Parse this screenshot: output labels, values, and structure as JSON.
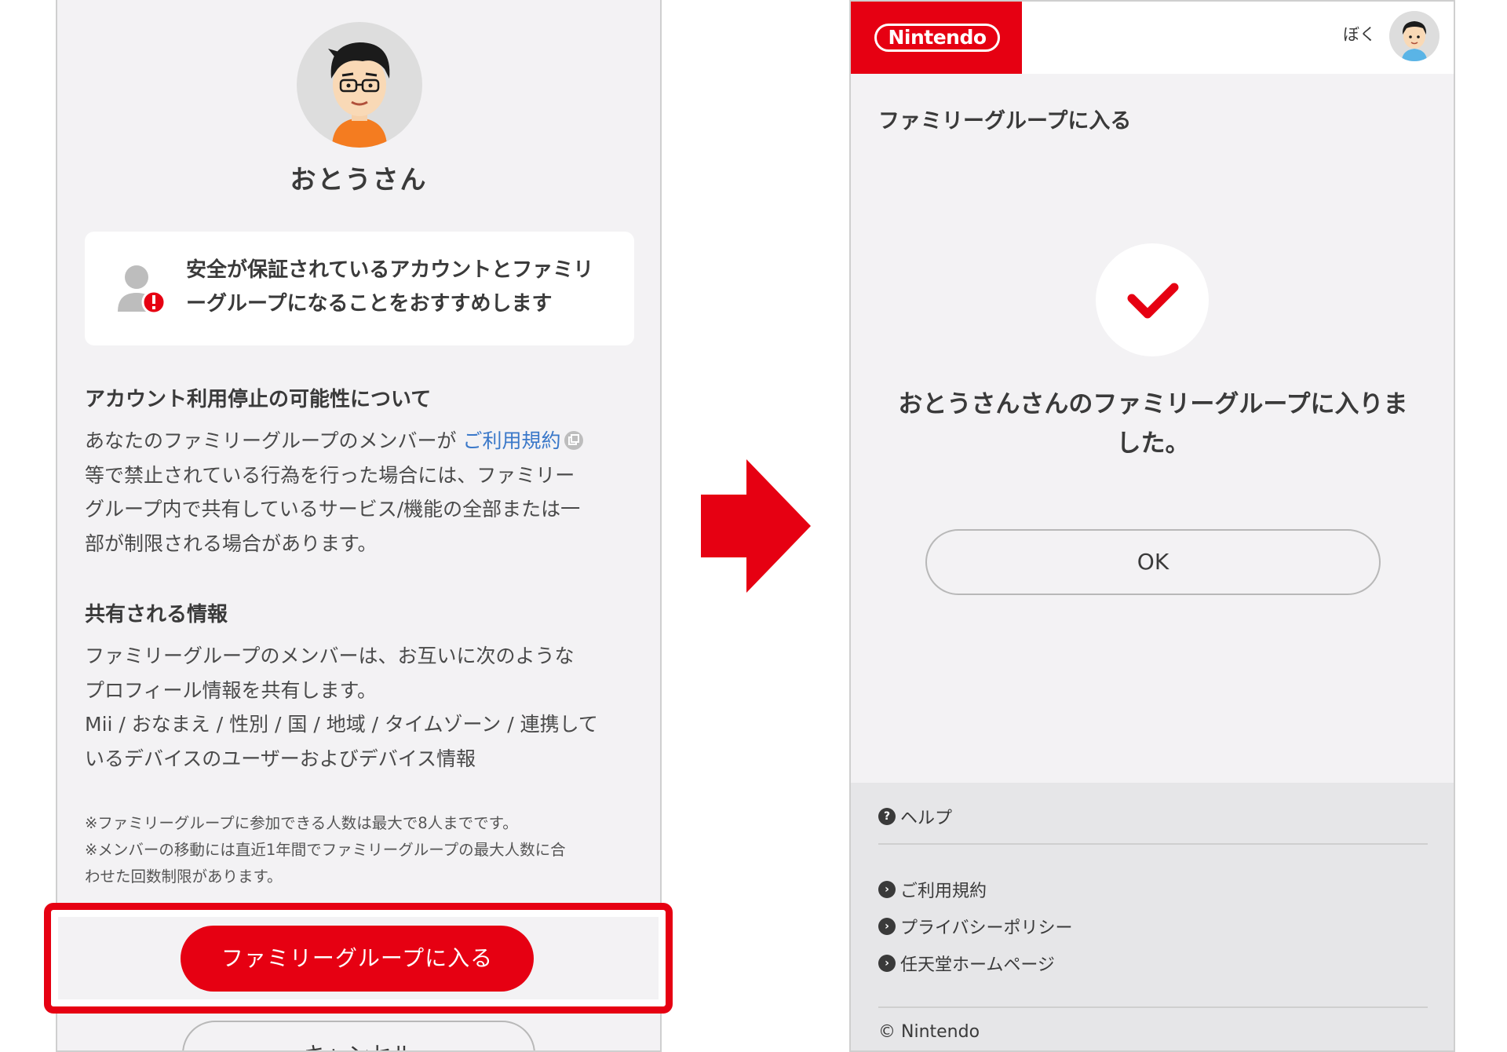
{
  "left": {
    "profile_name": "おとうさん",
    "warning": {
      "line1": "安全が保証されているアカウントとファミリ",
      "line2": "ーグループになることをおすすめします"
    },
    "section1": {
      "title": "アカウント利用停止の可能性について",
      "line1_pre": "あなたのファミリーグループのメンバーが ",
      "line1_link": "ご利用規約",
      "line2": "等で禁止されている行為を行った場合には、ファミリー",
      "line3": "グループ内で共有しているサービス/機能の全部または一",
      "line4": "部が制限される場合があります。"
    },
    "section2": {
      "title": "共有される情報",
      "line1": "ファミリーグループのメンバーは、お互いに次のような",
      "line2": "プロフィール情報を共有します。",
      "line3": "Mii / おなまえ / 性別 / 国 / 地域 / タイムゾーン / 連携して",
      "line4": "いるデバイスのユーザーおよびデバイス情報"
    },
    "notes": {
      "line1": "※ファミリーグループに参加できる人数は最大で8人までです。",
      "line2": "※メンバーの移動には直近1年間でファミリーグループの最大人数に合",
      "line3": "わせた回数制限があります。"
    },
    "join_button": "ファミリーグループに入る",
    "cancel_button": "キャンセル"
  },
  "right": {
    "logo": "Nintendo",
    "user_name": "ぼく",
    "page_title": "ファミリーグループに入る",
    "success_line1": "おとうさんさんのファミリーグループに入りま",
    "success_line2": "した。",
    "ok_button": "OK",
    "footer": {
      "help": "ヘルプ",
      "terms": "ご利用規約",
      "privacy": "プライバシーポリシー",
      "homepage": "任天堂ホームページ",
      "copyright": "© Nintendo"
    }
  },
  "colors": {
    "accent_red": "#e60012",
    "link_blue": "#3a78c9",
    "screen_bg": "#f3f2f4"
  },
  "icons": [
    "warning-user-icon",
    "external-link-icon",
    "right-arrow-icon",
    "checkmark-icon",
    "help-icon",
    "chevron-right-icon"
  ]
}
